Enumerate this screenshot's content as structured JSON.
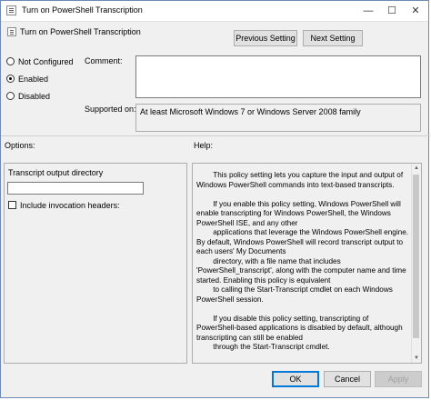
{
  "window": {
    "title": "Turn on PowerShell Transcription",
    "minimize": "—",
    "maximize": "☐",
    "close": "✕"
  },
  "header": {
    "policy_name": "Turn on PowerShell Transcription",
    "previous_label": "Previous Setting",
    "next_label": "Next Setting"
  },
  "state": {
    "not_configured": "Not Configured",
    "enabled": "Enabled",
    "disabled": "Disabled",
    "selected": "Enabled"
  },
  "comment": {
    "label": "Comment:",
    "value": ""
  },
  "supported": {
    "label": "Supported on:",
    "value": "At least Microsoft Windows 7 or Windows Server 2008 family"
  },
  "options": {
    "heading": "Options:",
    "directory_label": "Transcript output directory",
    "directory_value": "",
    "include_headers_label": "Include invocation headers:",
    "include_headers_checked": false
  },
  "help": {
    "heading": "Help:",
    "text": "        This policy setting lets you capture the input and output of Windows PowerShell commands into text-based transcripts.\n\n        If you enable this policy setting, Windows PowerShell will enable transcripting for Windows PowerShell, the Windows PowerShell ISE, and any other\n        applications that leverage the Windows PowerShell engine. By default, Windows PowerShell will record transcript output to each users' My Documents\n        directory, with a file name that includes 'PowerShell_transcript', along with the computer name and time started. Enabling this policy is equivalent\n        to calling the Start-Transcript cmdlet on each Windows PowerShell session.\n\n        If you disable this policy setting, transcripting of PowerShell-based applications is disabled by default, although transcripting can still be enabled\n        through the Start-Transcript cmdlet."
  },
  "footer": {
    "ok_label": "OK",
    "cancel_label": "Cancel",
    "apply_label": "Apply"
  }
}
